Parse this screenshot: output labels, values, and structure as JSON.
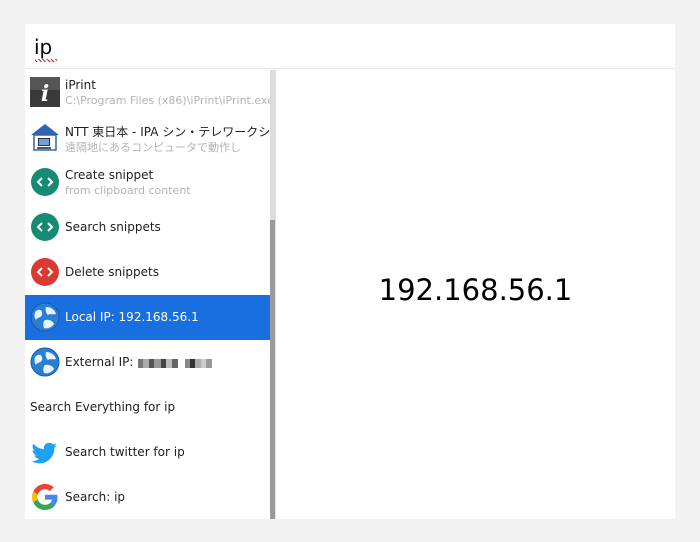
{
  "search": {
    "query": "ip"
  },
  "results": [
    {
      "title": "iPrint",
      "subtitle": "C:\\Program Files (x86)\\iPrint\\iPrint.exe",
      "icon": "iprint-app-icon"
    },
    {
      "title": "NTT 東日本 - IPA シン・テレワークシ",
      "subtitle": "遠隔地にあるコンピュータで動作し",
      "icon": "remote-desktop-icon"
    },
    {
      "title": "Create snippet",
      "subtitle": "from clipboard content",
      "icon": "snippet-icon"
    },
    {
      "title": "Search snippets",
      "icon": "snippet-icon"
    },
    {
      "title": "Delete snippets",
      "icon": "snippet-delete-icon"
    },
    {
      "title": "Local IP: 192.168.56.1",
      "icon": "globe-icon",
      "selected": true
    },
    {
      "title": "External IP:",
      "icon": "globe-icon"
    },
    {
      "title": "Search Everything for ip"
    },
    {
      "title": "Search twitter for ip",
      "icon": "twitter-icon"
    },
    {
      "title": "Search: ip",
      "icon": "google-icon"
    }
  ],
  "preview": {
    "value": "192.168.56.1"
  },
  "colors": {
    "selection": "#1a6fe0",
    "snippet_green": "#168a72",
    "snippet_red": "#d93a32",
    "twitter_blue": "#1da1f2"
  }
}
